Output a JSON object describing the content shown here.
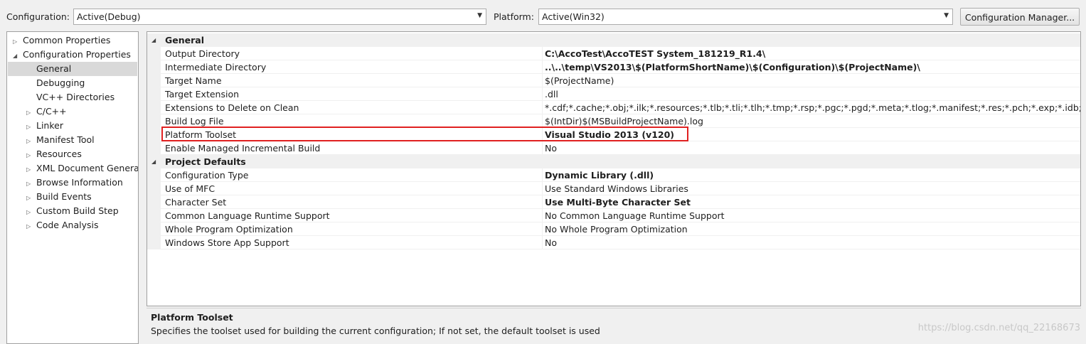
{
  "toolbar": {
    "configuration_label": "Configuration:",
    "configuration_value": "Active(Debug)",
    "platform_label": "Platform:",
    "platform_value": "Active(Win32)",
    "config_manager_button": "Configuration Manager..."
  },
  "tree": {
    "items": [
      {
        "label": "Common Properties",
        "expander": "collapsed",
        "level": 0
      },
      {
        "label": "Configuration Properties",
        "expander": "expanded",
        "level": 0
      },
      {
        "label": "General",
        "expander": "none",
        "level": 1,
        "selected": true
      },
      {
        "label": "Debugging",
        "expander": "none",
        "level": 1
      },
      {
        "label": "VC++ Directories",
        "expander": "none",
        "level": 1
      },
      {
        "label": "C/C++",
        "expander": "collapsed",
        "level": 1
      },
      {
        "label": "Linker",
        "expander": "collapsed",
        "level": 1
      },
      {
        "label": "Manifest Tool",
        "expander": "collapsed",
        "level": 1
      },
      {
        "label": "Resources",
        "expander": "collapsed",
        "level": 1
      },
      {
        "label": "XML Document Generat",
        "expander": "collapsed",
        "level": 1
      },
      {
        "label": "Browse Information",
        "expander": "collapsed",
        "level": 1
      },
      {
        "label": "Build Events",
        "expander": "collapsed",
        "level": 1
      },
      {
        "label": "Custom Build Step",
        "expander": "collapsed",
        "level": 1
      },
      {
        "label": "Code Analysis",
        "expander": "collapsed",
        "level": 1
      }
    ]
  },
  "grid": {
    "sections": [
      {
        "name": "General",
        "properties": [
          {
            "name": "Output Directory",
            "value": "C:\\AccoTest\\AccoTEST System_181219_R1.4\\",
            "bold": true
          },
          {
            "name": "Intermediate Directory",
            "value": "..\\..\\temp\\VS2013\\$(PlatformShortName)\\$(Configuration)\\$(ProjectName)\\",
            "bold": true
          },
          {
            "name": "Target Name",
            "value": "$(ProjectName)",
            "bold": false
          },
          {
            "name": "Target Extension",
            "value": ".dll",
            "bold": false
          },
          {
            "name": "Extensions to Delete on Clean",
            "value": "*.cdf;*.cache;*.obj;*.ilk;*.resources;*.tlb;*.tli;*.tlh;*.tmp;*.rsp;*.pgc;*.pgd;*.meta;*.tlog;*.manifest;*.res;*.pch;*.exp;*.idb;*.rep;*.xdc;*.pdb;",
            "bold": false
          },
          {
            "name": "Build Log File",
            "value": "$(IntDir)$(MSBuildProjectName).log",
            "bold": false
          },
          {
            "name": "Platform Toolset",
            "value": "Visual Studio 2013 (v120)",
            "bold": true
          },
          {
            "name": "Enable Managed Incremental Build",
            "value": "No",
            "bold": false
          }
        ]
      },
      {
        "name": "Project Defaults",
        "properties": [
          {
            "name": "Configuration Type",
            "value": "Dynamic Library (.dll)",
            "bold": true
          },
          {
            "name": "Use of MFC",
            "value": "Use Standard Windows Libraries",
            "bold": false
          },
          {
            "name": "Character Set",
            "value": "Use Multi-Byte Character Set",
            "bold": true
          },
          {
            "name": "Common Language Runtime Support",
            "value": "No Common Language Runtime Support",
            "bold": false
          },
          {
            "name": "Whole Program Optimization",
            "value": "No Whole Program Optimization",
            "bold": false
          },
          {
            "name": "Windows Store App Support",
            "value": "No",
            "bold": false
          }
        ]
      }
    ]
  },
  "description": {
    "title": "Platform Toolset",
    "text": "Specifies the toolset used for building the current configuration; If not set, the default toolset is used"
  },
  "watermark": "https://blog.csdn.net/qq_22168673",
  "colors": {
    "highlight": "#e02020",
    "selected_bg": "#d9d9d9"
  }
}
